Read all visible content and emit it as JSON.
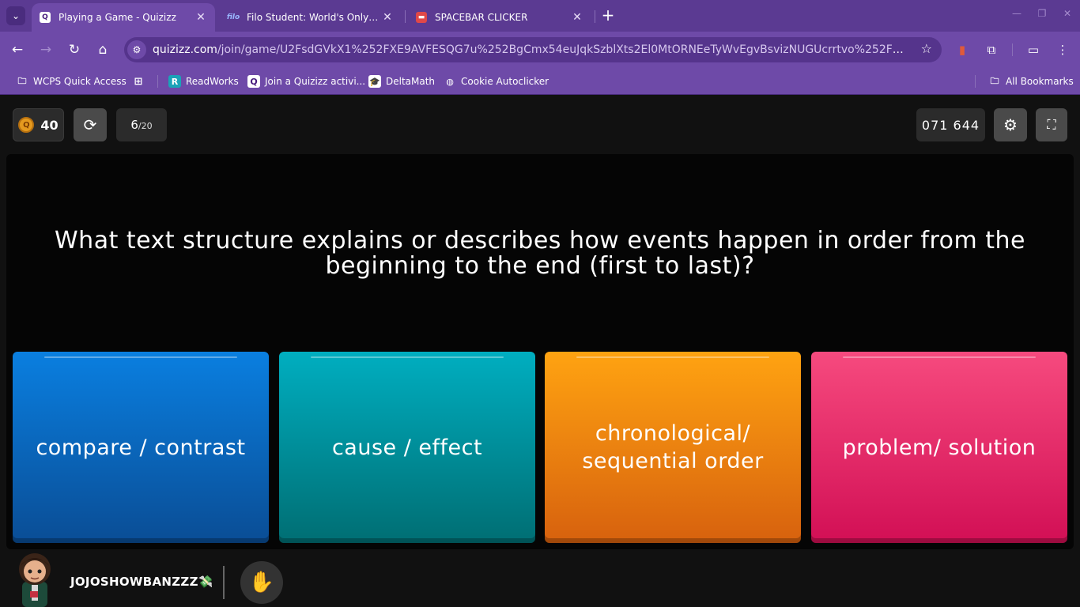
{
  "browser": {
    "tabs": [
      {
        "title": "Playing a Game - Quizizz",
        "favicon": "Q",
        "active": true
      },
      {
        "title": "Filo Student: World's Only Live I",
        "favicon": "filo",
        "active": false
      },
      {
        "title": "SPACEBAR CLICKER",
        "favicon": "game-controller-icon",
        "active": false
      }
    ],
    "url_host": "quizizz.com",
    "url_path": "/join/game/U2FsdGVkX1%252FXE9AVFESQG7u%252BgCmx54euJqkSzblXts2El0MtORNEeTyWvEgvBsvizNUGUcrrtvo%252FPagEiSGxxw%...",
    "bookmarks": [
      {
        "label": "WCPS Quick Access",
        "icon": "folder-icon"
      },
      {
        "label": "",
        "icon": "apps-grid-icon"
      },
      {
        "label": "ReadWorks",
        "icon": "R"
      },
      {
        "label": "Join a Quizizz activi...",
        "icon": "Q"
      },
      {
        "label": "DeltaMath",
        "icon": "graduation-cap-icon"
      },
      {
        "label": "Cookie Autoclicker",
        "icon": "globe-icon"
      }
    ],
    "all_bookmarks": "All Bookmarks"
  },
  "quiz": {
    "coins": "40",
    "progress_current": "6",
    "progress_total": "/20",
    "game_code": "071  644",
    "question": "What text structure explains or describes how events happen in order from the beginning to the end (first to last)?",
    "options": [
      {
        "label": "compare / contrast",
        "color": "#0a7fe0"
      },
      {
        "label": "cause / effect",
        "color": "#00aec0"
      },
      {
        "label": "chronological/ sequential order",
        "color": "#ffa311"
      },
      {
        "label": "problem/ solution",
        "color": "#f64a7e"
      }
    ]
  },
  "player": {
    "username": "JOJOSHOWBANZZZ💸"
  }
}
